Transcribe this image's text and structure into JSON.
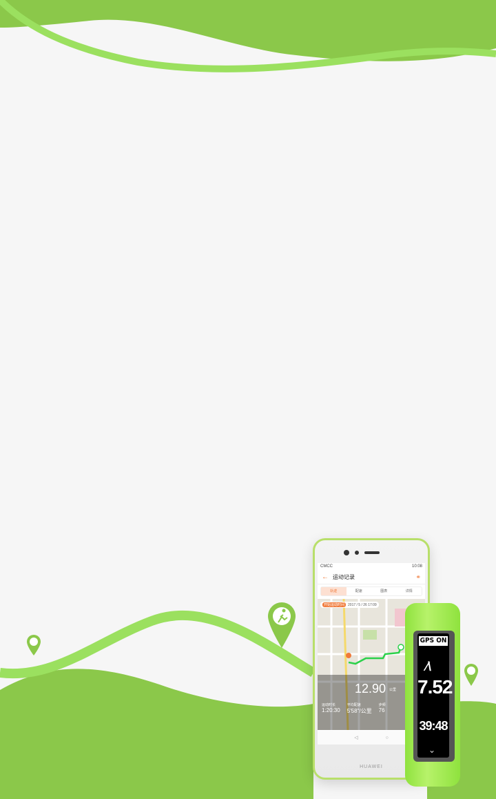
{
  "colors": {
    "accent": "#8bc84a",
    "accent_light": "#9be05f",
    "background": "#f6f6f6"
  },
  "icons": [
    "running-person-pin-icon"
  ],
  "phone": {
    "carrier": "CMCC",
    "clock": "10:08",
    "title": "运动记录",
    "tabs": [
      "轨迹",
      "配速",
      "图表",
      "详情"
    ],
    "map_tag": "开始运动时间",
    "map_date": "2017 / 5 / 26 17:09",
    "distance": "12.90",
    "distance_unit": "公里",
    "stats": [
      {
        "label": "运动时长",
        "value": "1:20:30"
      },
      {
        "label": "平均配速",
        "value": "5'58\"/公里"
      },
      {
        "label": "步频",
        "value": "76"
      }
    ],
    "brand": "HUAWEI"
  },
  "band": {
    "gps": "GPS ON",
    "speed": "7.52",
    "time": "39:48"
  }
}
